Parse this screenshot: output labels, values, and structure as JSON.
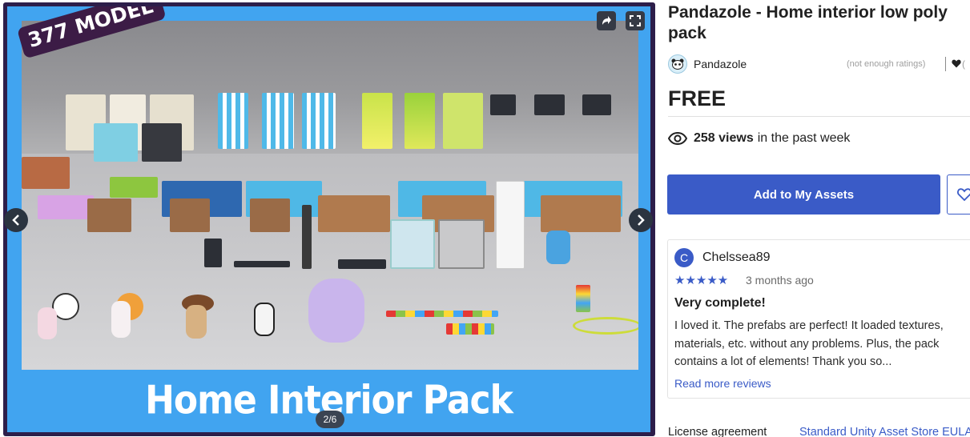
{
  "gallery": {
    "slide_caption": "Home Interior Pack",
    "badge": "377 MODEL",
    "counter": "2/6",
    "share_icon": "share-arrow-icon",
    "fullscreen_icon": "fullscreen-icon",
    "prev_icon": "chevron-left-icon",
    "next_icon": "chevron-right-icon",
    "colors": {
      "frame": "#2d1e4a",
      "slide_bg": "#41a4f0",
      "badge_bg": "#3c1c46"
    }
  },
  "product": {
    "title": "Pandazole - Home interior low poly pack",
    "publisher": "Pandazole",
    "ratings_note": "(not enough ratings)",
    "favorites_count": "(",
    "price": "FREE",
    "views_count": "258 views",
    "views_suffix": "in the past week"
  },
  "actions": {
    "add_label": "Add to My Assets",
    "accent": "#3a5bc7"
  },
  "review": {
    "avatar_letter": "C",
    "user": "Chelssea89",
    "stars": "★★★★★",
    "rating": 5,
    "time": "3 months ago",
    "title": "Very complete!",
    "body": "I loved it. The prefabs are perfect! It loaded textures, materials, etc. without any problems. Plus, the pack contains a lot of elements! Thank you so...",
    "read_more": "Read more reviews"
  },
  "license": {
    "label": "License agreement",
    "value": "Standard Unity Asset Store EULA"
  }
}
